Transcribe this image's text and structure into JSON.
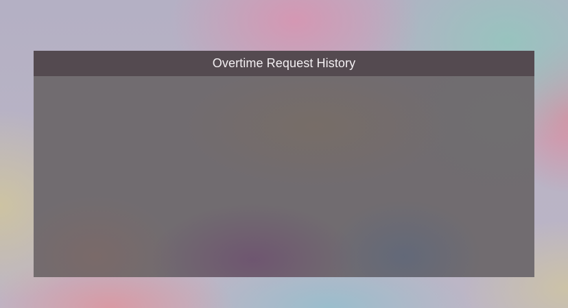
{
  "window": {
    "title": "Overtime Request History"
  },
  "colors": {
    "header_background": "#544a50",
    "panel_background": "#716c70",
    "title_text": "#f3eff2"
  },
  "history": {
    "entries": []
  }
}
